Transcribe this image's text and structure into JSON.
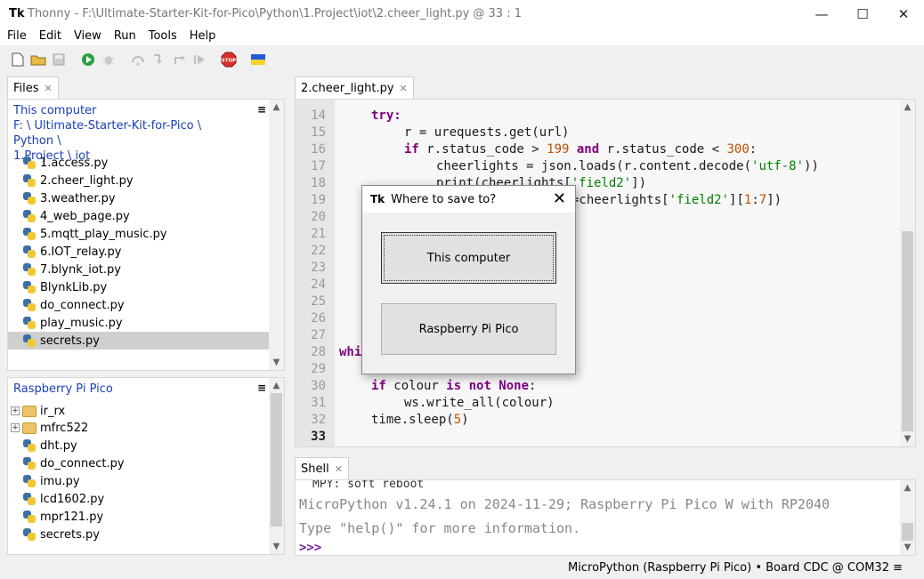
{
  "window": {
    "title": "Thonny  -  F:\\Ultimate-Starter-Kit-for-Pico\\Python\\1.Project\\iot\\2.cheer_light.py  @  33 : 1",
    "app_icon": "Tk",
    "minimize": "—",
    "maximize": "☐",
    "close": "✕"
  },
  "menu": [
    "File",
    "Edit",
    "View",
    "Run",
    "Tools",
    "Help"
  ],
  "toolbar": {
    "icons": [
      "new-file-icon",
      "open-folder-icon",
      "save-icon",
      "run-icon",
      "debug-icon",
      "step-over-icon",
      "step-into-icon",
      "step-out-icon",
      "resume-icon",
      "stop-icon",
      "ukraine-flag-icon"
    ],
    "stop_label": "STOP"
  },
  "files_panel": {
    "tab_label": "Files",
    "computer": {
      "heading": "This computer",
      "path_line1": "F: \\ Ultimate-Starter-Kit-for-Pico \\ Python \\",
      "path_line2": "1.Project \\ iot",
      "files": [
        "1.access.py",
        "2.cheer_light.py",
        "3.weather.py",
        "4_web_page.py",
        "5.mqtt_play_music.py",
        "6.IOT_relay.py",
        "7.blynk_iot.py",
        "BlynkLib.py",
        "do_connect.py",
        "play_music.py",
        "secrets.py"
      ],
      "selected": "secrets.py"
    },
    "pico": {
      "heading": "Raspberry Pi Pico",
      "folders": [
        "ir_rx",
        "mfrc522"
      ],
      "files": [
        "dht.py",
        "do_connect.py",
        "imu.py",
        "lcd1602.py",
        "mpr121.py",
        "secrets.py"
      ]
    },
    "menu_glyph": "≡"
  },
  "editor": {
    "tab_label": "2.cheer_light.py",
    "line_numbers": [
      "14",
      "15",
      "16",
      "17",
      "18",
      "19",
      "20",
      "21",
      "22",
      "23",
      "24",
      "25",
      "26",
      "27",
      "28",
      "29",
      "30",
      "31",
      "32",
      "33"
    ],
    "current_line": "33",
    "code": {
      "l14_kw": "try:",
      "l15": "r = urequests.get(url)",
      "l16_if": "if",
      "l16_a": " r.status_code > ",
      "l16_n1": "199",
      "l16_and": " and",
      "l16_b": " r.status_code < ",
      "l16_n2": "300",
      "l16_c": ":",
      "l17_a": "cheerlights = json.loads(r.content.decode(",
      "l17_s": "'utf-8'",
      "l17_b": "))",
      "l18_a": "print(cheerlights[",
      "l18_s": "'field2'",
      "l18_b": "])",
      "l19_a": "=cheerlights[",
      "l19_s": "'field2'",
      "l19_b": "][",
      "l19_n1": "1",
      "l19_c": ":",
      "l19_n2": "7",
      "l19_d": "])",
      "l28_kw": "whi",
      "l30_if": "if",
      "l30_a": " colour ",
      "l30_is": "is not None",
      "l30_b": ":",
      "l31": "ws.write_all(colour)",
      "l32_a": "time.sleep(",
      "l32_n": "5",
      "l32_b": ")"
    }
  },
  "shell": {
    "tab_label": "Shell",
    "line1": "MPY: soft reboot",
    "line2": "MicroPython v1.24.1 on 2024-11-29; Raspberry Pi Pico W with RP2040",
    "line3": "Type \"help()\" for more information.",
    "prompt": ">>>"
  },
  "status": {
    "text": "MicroPython (Raspberry Pi Pico)  •  Board CDC @ COM32  ≡"
  },
  "dialog": {
    "title": "Where to save to?",
    "close": "✕",
    "option_computer": "This computer",
    "option_pico": "Raspberry Pi Pico"
  },
  "colors": {
    "accent_path": "#1a40b8",
    "keyword": "#800080",
    "number": "#c05000",
    "string": "#008000",
    "stop_red": "#d9302b"
  }
}
